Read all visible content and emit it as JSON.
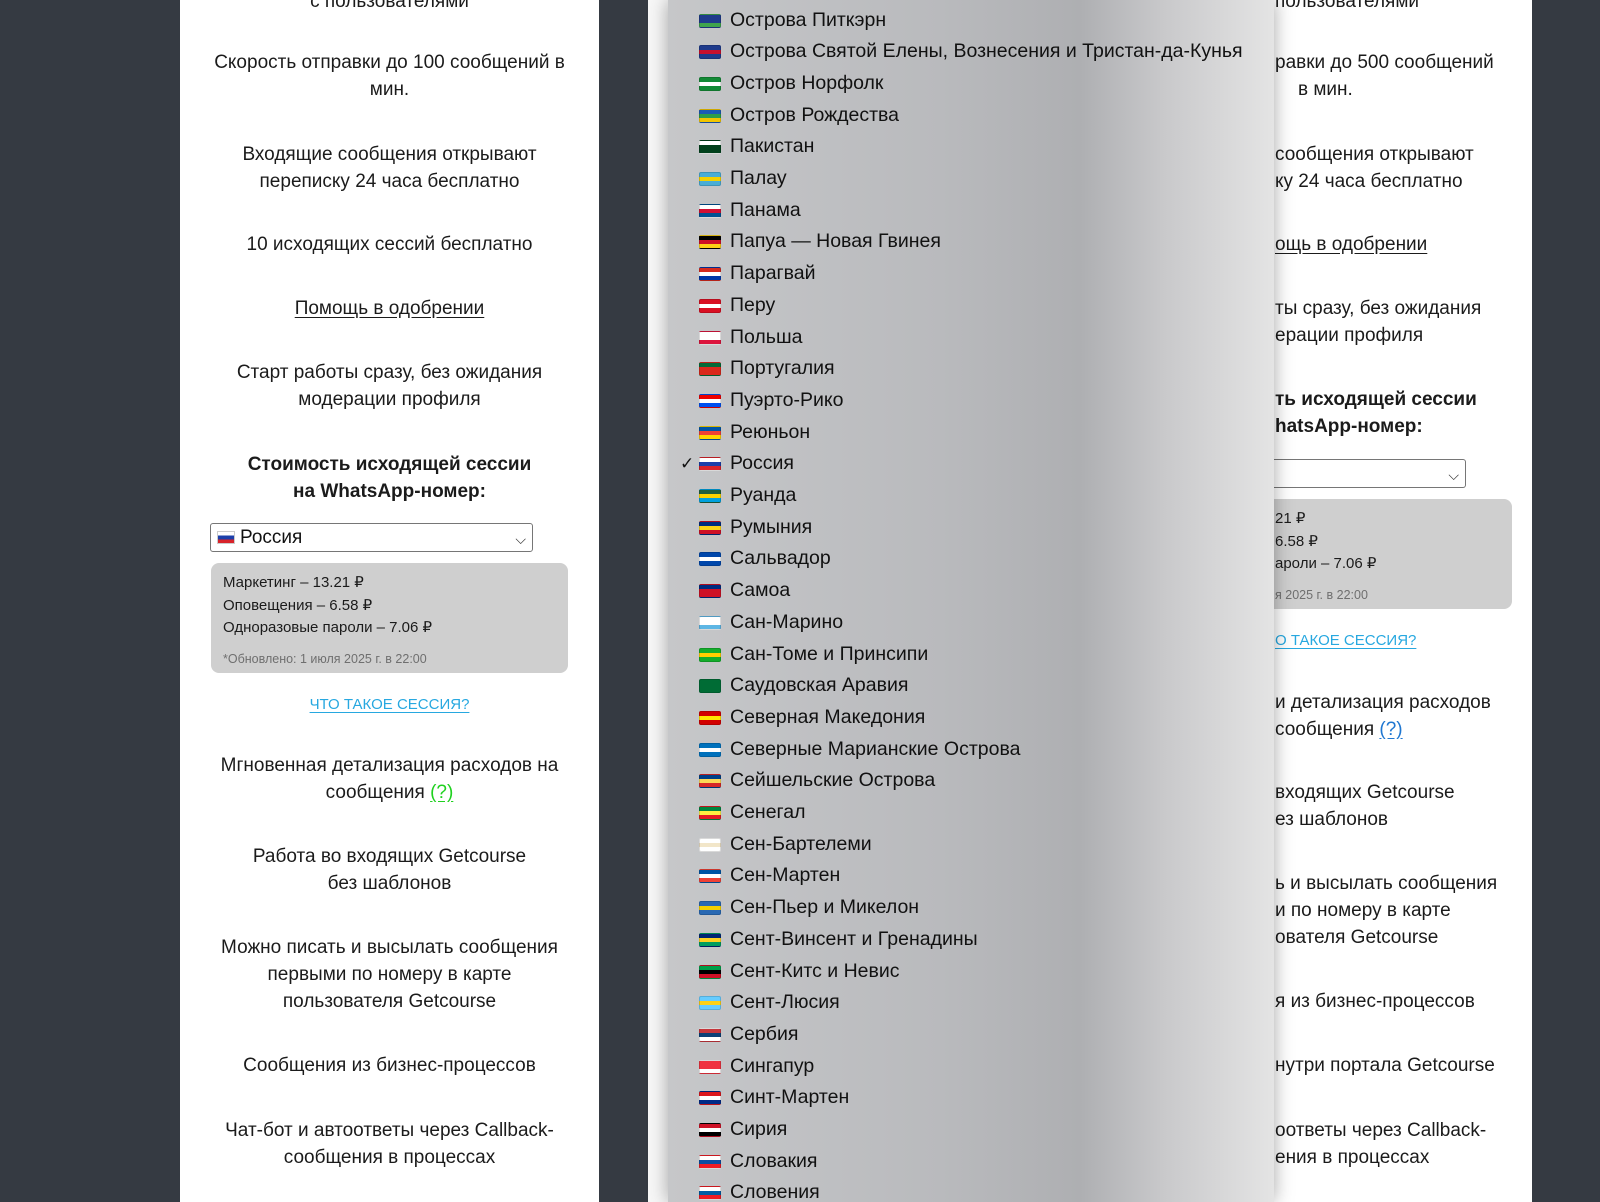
{
  "left_card": {
    "top_cut": "с пользователями",
    "speed": "Скорость отправки до 100 сообщений в мин.",
    "incoming": "Входящие сообщения открывают переписку 24 часа бесплатно",
    "outgoing_free": "10 исходящих сессий бесплатно",
    "help_link": "Помощь в одобрении",
    "start": "Старт работы сразу, без ожидания модерации профиля",
    "cost_title_1": "Стоимость исходящей сессии",
    "cost_title_2": "на WhatsApp-номер:",
    "country_selected": "Россия",
    "price_marketing": "Маркетинг – 13.21 ₽",
    "price_notify": "Оповещения – 6.58 ₽",
    "price_otp": "Одноразовые пароли – 7.06 ₽",
    "updated": "*Обновлено: 1 июля 2025 г. в 22:00",
    "what_session": "ЧТО ТАКОЕ СЕССИЯ?",
    "details": "Мгновенная детализация расходов на сообщения",
    "details_q": "(?)",
    "getcourse_incoming_1": "Работа во входящих Getcourse",
    "getcourse_incoming_2": "без шаблонов",
    "write_first": "Можно писать и высылать сообщения первыми по номеру в карте пользователя Getcourse",
    "bp": "Сообщения из бизнес-процессов",
    "chatbot": "Чат-бот и автоответы через Callback-сообщения в процессах"
  },
  "right_card": {
    "top_cut": "пользователями",
    "speed_1": "равки до 500 сообщений",
    "speed_2": "в мин.",
    "incoming_1": "сообщения открывают",
    "incoming_2": "ку 24 часа бесплатно",
    "help_link": "ощь в одобрении",
    "start_1": "ты сразу, без ожидания",
    "start_2": "ерации профиля",
    "cost_1": "ть исходящей сессии",
    "cost_2": "hatsApp-номер:",
    "price_marketing": "21 ₽",
    "price_notify": "6.58 ₽",
    "price_otp": "ароли – 7.06 ₽",
    "updated": "я 2025 г. в 22:00",
    "what_session": "О ТАКОЕ СЕССИЯ?",
    "details_1": "и детализация расходов",
    "details_2": "сообщения",
    "details_q": "(?)",
    "incoming_gc_1": "входящих Getcourse",
    "incoming_gc_2": "ез шаблонов",
    "write_1": "ь и высылать сообщения",
    "write_2": "и по номеру в карте",
    "write_3": "ователя Getcourse",
    "bp": "я из бизнес-процессов",
    "portal": "нутри портала Getcourse",
    "chatbot_1": "оответы через Callback-",
    "chatbot_2": "ения в процессах"
  },
  "dropdown": {
    "check_mark": "✓",
    "options": [
      {
        "name": "Острова Питкэрн",
        "colors": [
          "#1f3b8c",
          "#1f3b8c",
          "#3fa34d"
        ],
        "selected": false
      },
      {
        "name": "Острова Святой Елены, Вознесения и Тристан-да-Кунья",
        "colors": [
          "#1f3b8c",
          "#c8102e",
          "#1f3b8c"
        ],
        "selected": false
      },
      {
        "name": "Остров Норфолк",
        "colors": [
          "#138a36",
          "#ffffff",
          "#138a36"
        ],
        "selected": false
      },
      {
        "name": "Остров Рождества",
        "colors": [
          "#1c5bb5",
          "#2e9e4a",
          "#f2c500"
        ],
        "selected": false
      },
      {
        "name": "Пакистан",
        "colors": [
          "#ffffff",
          "#01411c",
          "#01411c"
        ],
        "selected": false
      },
      {
        "name": "Палау",
        "colors": [
          "#4aadd6",
          "#f5d000",
          "#4aadd6"
        ],
        "selected": false
      },
      {
        "name": "Панама",
        "colors": [
          "#ffffff",
          "#d21034",
          "#005293"
        ],
        "selected": false
      },
      {
        "name": "Папуа — Новая Гвинея",
        "colors": [
          "#000000",
          "#ce1126",
          "#fcd116"
        ],
        "selected": false
      },
      {
        "name": "Парагвай",
        "colors": [
          "#d52b1e",
          "#ffffff",
          "#0038a8"
        ],
        "selected": false
      },
      {
        "name": "Перу",
        "colors": [
          "#d91023",
          "#ffffff",
          "#d91023"
        ],
        "selected": false
      },
      {
        "name": "Польша",
        "colors": [
          "#ffffff",
          "#ffffff",
          "#dc143c"
        ],
        "selected": false
      },
      {
        "name": "Португалия",
        "colors": [
          "#046a38",
          "#da291c",
          "#da291c"
        ],
        "selected": false
      },
      {
        "name": "Пуэрто-Рико",
        "colors": [
          "#ed0000",
          "#ffffff",
          "#0050f0"
        ],
        "selected": false
      },
      {
        "name": "Реюньон",
        "colors": [
          "#0055a4",
          "#ef4135",
          "#ffd500"
        ],
        "selected": false
      },
      {
        "name": "Россия",
        "colors": [
          "#ffffff",
          "#1c3faa",
          "#d8232a"
        ],
        "selected": true
      },
      {
        "name": "Руанда",
        "colors": [
          "#20603d",
          "#fad201",
          "#00a1de"
        ],
        "selected": false
      },
      {
        "name": "Румыния",
        "colors": [
          "#002b7f",
          "#fcd116",
          "#ce1126"
        ],
        "selected": false
      },
      {
        "name": "Сальвадор",
        "colors": [
          "#0047ab",
          "#ffffff",
          "#0047ab"
        ],
        "selected": false
      },
      {
        "name": "Самоа",
        "colors": [
          "#002b7f",
          "#ce1126",
          "#ce1126"
        ],
        "selected": false
      },
      {
        "name": "Сан-Марино",
        "colors": [
          "#ffffff",
          "#ffffff",
          "#5eb6e4"
        ],
        "selected": false
      },
      {
        "name": "Сан-Томе и Принсипи",
        "colors": [
          "#12ad2b",
          "#ffce00",
          "#12ad2b"
        ],
        "selected": false
      },
      {
        "name": "Саудовская Аравия",
        "colors": [
          "#006c35",
          "#006c35",
          "#006c35"
        ],
        "selected": false
      },
      {
        "name": "Северная Македония",
        "colors": [
          "#d20000",
          "#ffe600",
          "#d20000"
        ],
        "selected": false
      },
      {
        "name": "Северные Марианские Острова",
        "colors": [
          "#0071bc",
          "#ffffff",
          "#0071bc"
        ],
        "selected": false
      },
      {
        "name": "Сейшельские Острова",
        "colors": [
          "#003f87",
          "#fcd856",
          "#d62828"
        ],
        "selected": false
      },
      {
        "name": "Сенегал",
        "colors": [
          "#00853f",
          "#fdef42",
          "#e31b23"
        ],
        "selected": false
      },
      {
        "name": "Сен-Бартелеми",
        "colors": [
          "#ffffff",
          "#f2e6c9",
          "#ffffff"
        ],
        "selected": false
      },
      {
        "name": "Сен-Мартен",
        "colors": [
          "#0055a4",
          "#ffffff",
          "#ef4135"
        ],
        "selected": false
      },
      {
        "name": "Сен-Пьер и Микелон",
        "colors": [
          "#2a69b3",
          "#f5d000",
          "#2a69b3"
        ],
        "selected": false
      },
      {
        "name": "Сент-Винсент и Гренадины",
        "colors": [
          "#002674",
          "#fcd022",
          "#009e60"
        ],
        "selected": false
      },
      {
        "name": "Сент-Китс и Невис",
        "colors": [
          "#009e49",
          "#000000",
          "#ce1126"
        ],
        "selected": false
      },
      {
        "name": "Сент-Люсия",
        "colors": [
          "#66ccff",
          "#fcd116",
          "#66ccff"
        ],
        "selected": false
      },
      {
        "name": "Сербия",
        "colors": [
          "#c6363c",
          "#0c4076",
          "#ffffff"
        ],
        "selected": false
      },
      {
        "name": "Сингапур",
        "colors": [
          "#ef3340",
          "#ef3340",
          "#ffffff"
        ],
        "selected": false
      },
      {
        "name": "Синт-Мартен",
        "colors": [
          "#dc171d",
          "#ffffff",
          "#012a87"
        ],
        "selected": false
      },
      {
        "name": "Сирия",
        "colors": [
          "#ce1126",
          "#ffffff",
          "#000000"
        ],
        "selected": false
      },
      {
        "name": "Словакия",
        "colors": [
          "#ffffff",
          "#0b4ea2",
          "#ee1c25"
        ],
        "selected": false
      },
      {
        "name": "Словения",
        "colors": [
          "#ffffff",
          "#005da4",
          "#ed1c24"
        ],
        "selected": false
      }
    ]
  }
}
